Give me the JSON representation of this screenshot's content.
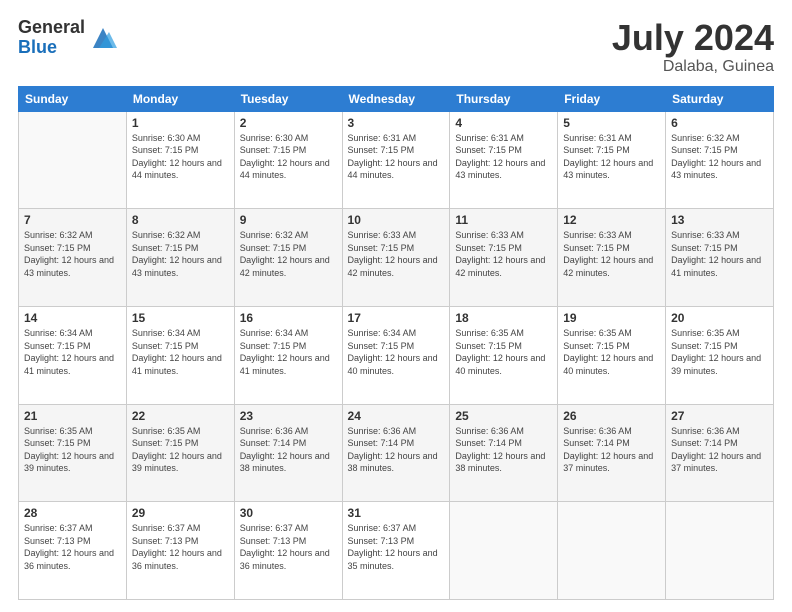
{
  "logo": {
    "general": "General",
    "blue": "Blue"
  },
  "title": {
    "month_year": "July 2024",
    "location": "Dalaba, Guinea"
  },
  "weekdays": [
    "Sunday",
    "Monday",
    "Tuesday",
    "Wednesday",
    "Thursday",
    "Friday",
    "Saturday"
  ],
  "weeks": [
    [
      {
        "day": "",
        "sunrise": "",
        "sunset": "",
        "daylight": ""
      },
      {
        "day": "1",
        "sunrise": "Sunrise: 6:30 AM",
        "sunset": "Sunset: 7:15 PM",
        "daylight": "Daylight: 12 hours and 44 minutes."
      },
      {
        "day": "2",
        "sunrise": "Sunrise: 6:30 AM",
        "sunset": "Sunset: 7:15 PM",
        "daylight": "Daylight: 12 hours and 44 minutes."
      },
      {
        "day": "3",
        "sunrise": "Sunrise: 6:31 AM",
        "sunset": "Sunset: 7:15 PM",
        "daylight": "Daylight: 12 hours and 44 minutes."
      },
      {
        "day": "4",
        "sunrise": "Sunrise: 6:31 AM",
        "sunset": "Sunset: 7:15 PM",
        "daylight": "Daylight: 12 hours and 43 minutes."
      },
      {
        "day": "5",
        "sunrise": "Sunrise: 6:31 AM",
        "sunset": "Sunset: 7:15 PM",
        "daylight": "Daylight: 12 hours and 43 minutes."
      },
      {
        "day": "6",
        "sunrise": "Sunrise: 6:32 AM",
        "sunset": "Sunset: 7:15 PM",
        "daylight": "Daylight: 12 hours and 43 minutes."
      }
    ],
    [
      {
        "day": "7",
        "sunrise": "Sunrise: 6:32 AM",
        "sunset": "Sunset: 7:15 PM",
        "daylight": "Daylight: 12 hours and 43 minutes."
      },
      {
        "day": "8",
        "sunrise": "Sunrise: 6:32 AM",
        "sunset": "Sunset: 7:15 PM",
        "daylight": "Daylight: 12 hours and 43 minutes."
      },
      {
        "day": "9",
        "sunrise": "Sunrise: 6:32 AM",
        "sunset": "Sunset: 7:15 PM",
        "daylight": "Daylight: 12 hours and 42 minutes."
      },
      {
        "day": "10",
        "sunrise": "Sunrise: 6:33 AM",
        "sunset": "Sunset: 7:15 PM",
        "daylight": "Daylight: 12 hours and 42 minutes."
      },
      {
        "day": "11",
        "sunrise": "Sunrise: 6:33 AM",
        "sunset": "Sunset: 7:15 PM",
        "daylight": "Daylight: 12 hours and 42 minutes."
      },
      {
        "day": "12",
        "sunrise": "Sunrise: 6:33 AM",
        "sunset": "Sunset: 7:15 PM",
        "daylight": "Daylight: 12 hours and 42 minutes."
      },
      {
        "day": "13",
        "sunrise": "Sunrise: 6:33 AM",
        "sunset": "Sunset: 7:15 PM",
        "daylight": "Daylight: 12 hours and 41 minutes."
      }
    ],
    [
      {
        "day": "14",
        "sunrise": "Sunrise: 6:34 AM",
        "sunset": "Sunset: 7:15 PM",
        "daylight": "Daylight: 12 hours and 41 minutes."
      },
      {
        "day": "15",
        "sunrise": "Sunrise: 6:34 AM",
        "sunset": "Sunset: 7:15 PM",
        "daylight": "Daylight: 12 hours and 41 minutes."
      },
      {
        "day": "16",
        "sunrise": "Sunrise: 6:34 AM",
        "sunset": "Sunset: 7:15 PM",
        "daylight": "Daylight: 12 hours and 41 minutes."
      },
      {
        "day": "17",
        "sunrise": "Sunrise: 6:34 AM",
        "sunset": "Sunset: 7:15 PM",
        "daylight": "Daylight: 12 hours and 40 minutes."
      },
      {
        "day": "18",
        "sunrise": "Sunrise: 6:35 AM",
        "sunset": "Sunset: 7:15 PM",
        "daylight": "Daylight: 12 hours and 40 minutes."
      },
      {
        "day": "19",
        "sunrise": "Sunrise: 6:35 AM",
        "sunset": "Sunset: 7:15 PM",
        "daylight": "Daylight: 12 hours and 40 minutes."
      },
      {
        "day": "20",
        "sunrise": "Sunrise: 6:35 AM",
        "sunset": "Sunset: 7:15 PM",
        "daylight": "Daylight: 12 hours and 39 minutes."
      }
    ],
    [
      {
        "day": "21",
        "sunrise": "Sunrise: 6:35 AM",
        "sunset": "Sunset: 7:15 PM",
        "daylight": "Daylight: 12 hours and 39 minutes."
      },
      {
        "day": "22",
        "sunrise": "Sunrise: 6:35 AM",
        "sunset": "Sunset: 7:15 PM",
        "daylight": "Daylight: 12 hours and 39 minutes."
      },
      {
        "day": "23",
        "sunrise": "Sunrise: 6:36 AM",
        "sunset": "Sunset: 7:14 PM",
        "daylight": "Daylight: 12 hours and 38 minutes."
      },
      {
        "day": "24",
        "sunrise": "Sunrise: 6:36 AM",
        "sunset": "Sunset: 7:14 PM",
        "daylight": "Daylight: 12 hours and 38 minutes."
      },
      {
        "day": "25",
        "sunrise": "Sunrise: 6:36 AM",
        "sunset": "Sunset: 7:14 PM",
        "daylight": "Daylight: 12 hours and 38 minutes."
      },
      {
        "day": "26",
        "sunrise": "Sunrise: 6:36 AM",
        "sunset": "Sunset: 7:14 PM",
        "daylight": "Daylight: 12 hours and 37 minutes."
      },
      {
        "day": "27",
        "sunrise": "Sunrise: 6:36 AM",
        "sunset": "Sunset: 7:14 PM",
        "daylight": "Daylight: 12 hours and 37 minutes."
      }
    ],
    [
      {
        "day": "28",
        "sunrise": "Sunrise: 6:37 AM",
        "sunset": "Sunset: 7:13 PM",
        "daylight": "Daylight: 12 hours and 36 minutes."
      },
      {
        "day": "29",
        "sunrise": "Sunrise: 6:37 AM",
        "sunset": "Sunset: 7:13 PM",
        "daylight": "Daylight: 12 hours and 36 minutes."
      },
      {
        "day": "30",
        "sunrise": "Sunrise: 6:37 AM",
        "sunset": "Sunset: 7:13 PM",
        "daylight": "Daylight: 12 hours and 36 minutes."
      },
      {
        "day": "31",
        "sunrise": "Sunrise: 6:37 AM",
        "sunset": "Sunset: 7:13 PM",
        "daylight": "Daylight: 12 hours and 35 minutes."
      },
      {
        "day": "",
        "sunrise": "",
        "sunset": "",
        "daylight": ""
      },
      {
        "day": "",
        "sunrise": "",
        "sunset": "",
        "daylight": ""
      },
      {
        "day": "",
        "sunrise": "",
        "sunset": "",
        "daylight": ""
      }
    ]
  ]
}
